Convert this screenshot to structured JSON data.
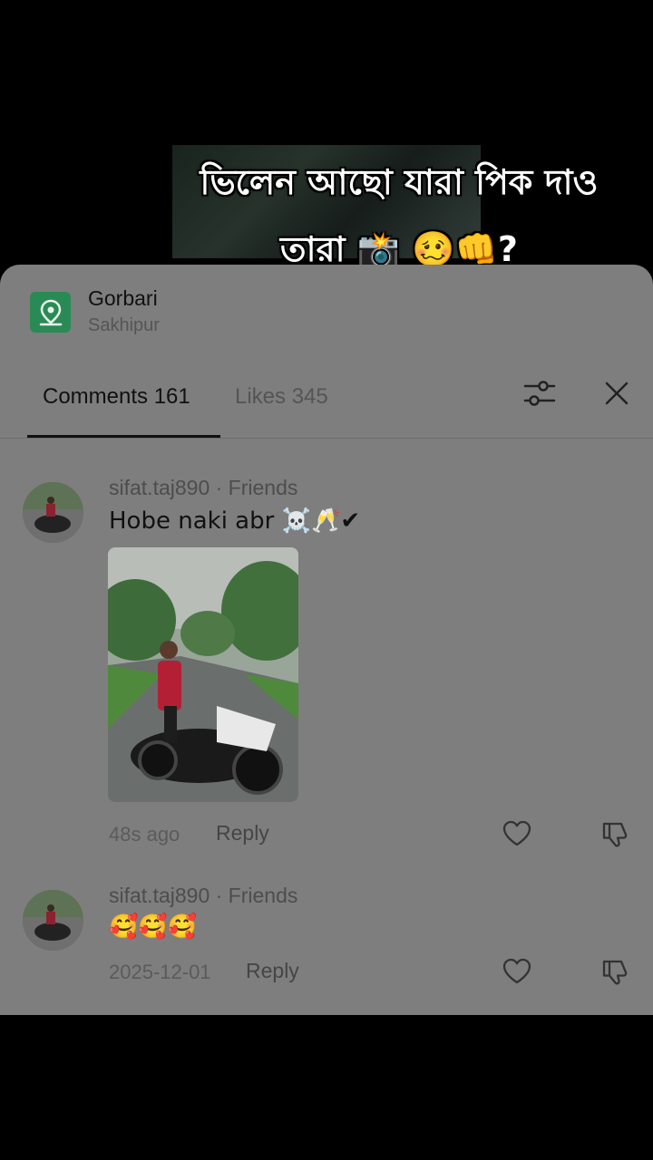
{
  "video": {
    "caption_line1": "ভিলেন আছো যারা পিক দাও",
    "caption_line2": "তারা 📸 🥴👊?"
  },
  "location": {
    "title": "Gorbari",
    "subtitle": "Sakhipur",
    "icon": "map-pin-icon",
    "icon_color": "#2a8a55"
  },
  "tabs": {
    "comments": "Comments 161",
    "likes": "Likes 345"
  },
  "comments": [
    {
      "meta": "sifat.taj890 · Friends",
      "text": "Hobe naki abr ☠️🥂✔",
      "time": "48s ago",
      "reply": "Reply"
    },
    {
      "meta": "sifat.taj890 · Friends",
      "text": "🥰🥰🥰",
      "time": "2025-12-01",
      "reply": "Reply"
    }
  ],
  "colors": {
    "sheet_bg": "#7e7e7e",
    "accent": "#111111"
  }
}
